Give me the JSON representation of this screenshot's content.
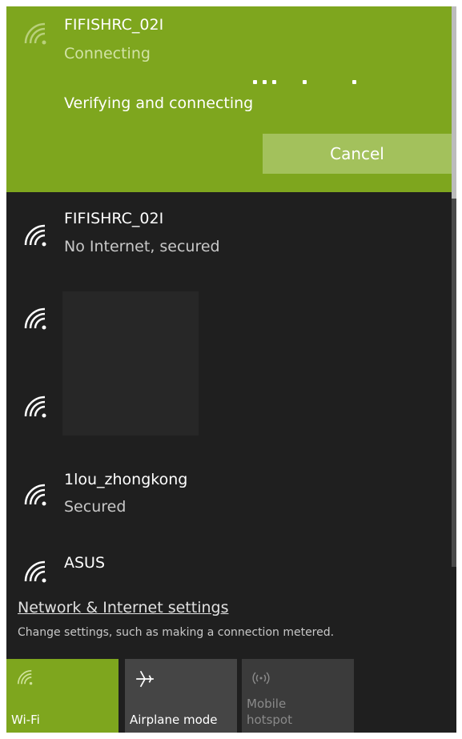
{
  "active": {
    "ssid": "FIFISHRC_02I",
    "status": "Connecting",
    "verify": "Verifying and connecting",
    "cancel_label": "Cancel"
  },
  "networks": [
    {
      "name": "FIFISHRC_02I",
      "status": "No Internet, secured"
    },
    {
      "name": "",
      "status": ""
    },
    {
      "name": "",
      "status": ""
    },
    {
      "name": "1lou_zhongkong",
      "status": "Secured"
    },
    {
      "name": "ASUS",
      "status": ""
    }
  ],
  "settings": {
    "link": "Network & Internet settings",
    "desc": "Change settings, such as making a connection metered."
  },
  "quick_actions": [
    {
      "label": "Wi-Fi",
      "icon": "wifi-icon",
      "active": true
    },
    {
      "label": "Airplane mode",
      "icon": "airplane-icon",
      "active": false
    },
    {
      "label": "Mobile\nhotspot",
      "icon": "hotspot-icon",
      "active": false,
      "disabled": true
    }
  ],
  "colors": {
    "accent": "#7ea61e",
    "background": "#1f1f1f",
    "tile": "#3b3b3b"
  }
}
